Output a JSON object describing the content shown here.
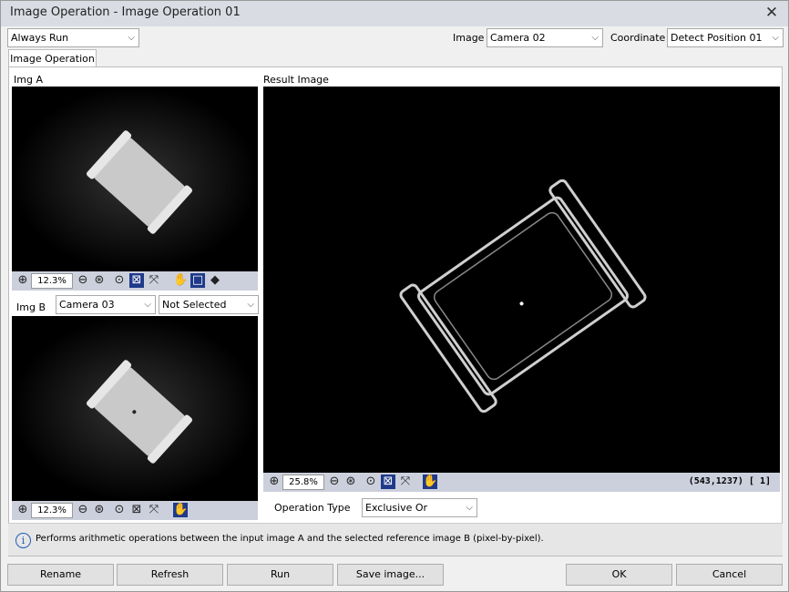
{
  "window": {
    "title": "Image Operation - Image Operation 01",
    "close": "✕"
  },
  "top": {
    "run_mode": "Always Run",
    "image_label": "Image",
    "image_value": "Camera 02",
    "coordinate_label": "Coordinate",
    "coordinate_value": "Detect Position 01"
  },
  "tab": {
    "label": "Image Operation"
  },
  "img_a": {
    "label": "Img A",
    "zoom": "12.3%"
  },
  "img_b": {
    "label": "Img B",
    "camera": "Camera 03",
    "selection": "Not Selected",
    "zoom": "12.3%"
  },
  "result": {
    "label": "Result Image",
    "zoom": "25.8%",
    "coords": "(543,1237) [   1]"
  },
  "operation": {
    "label": "Operation Type",
    "value": "Exclusive Or"
  },
  "info": {
    "icon": "info-icon",
    "text": "Performs arithmetic operations between the input image A and the selected reference image B (pixel-by-pixel)."
  },
  "buttons": {
    "rename": "Rename",
    "refresh": "Refresh",
    "run": "Run",
    "save": "Save image...",
    "ok": "OK",
    "cancel": "Cancel"
  },
  "icons": {
    "dropdown_arrow": "⌵"
  }
}
